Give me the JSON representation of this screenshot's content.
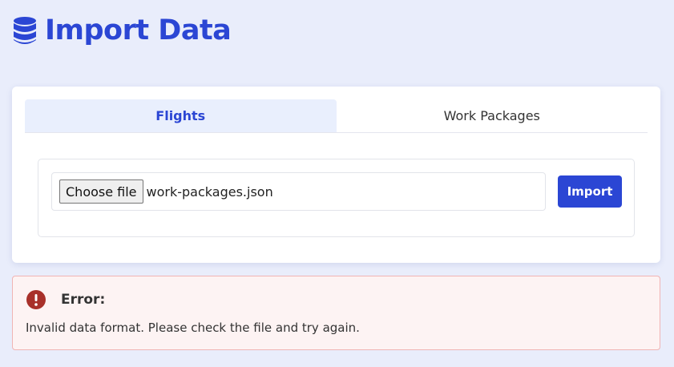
{
  "header": {
    "icon": "database-icon",
    "title": "Import Data"
  },
  "tabs": [
    {
      "label": "Flights",
      "active": true
    },
    {
      "label": "Work Packages",
      "active": false
    }
  ],
  "upload": {
    "choose_label": "Choose file",
    "file_name": "work-packages.json",
    "import_label": "Import"
  },
  "alert": {
    "icon": "error-circle-icon",
    "title": "Error:",
    "message": "Invalid data format. Please check the file and try again."
  },
  "colors": {
    "brand": "#2b46d4",
    "background": "#e9edfb",
    "error_icon": "#a8302a",
    "error_bg": "#fdf3f3",
    "error_border": "#f0b4b4"
  }
}
